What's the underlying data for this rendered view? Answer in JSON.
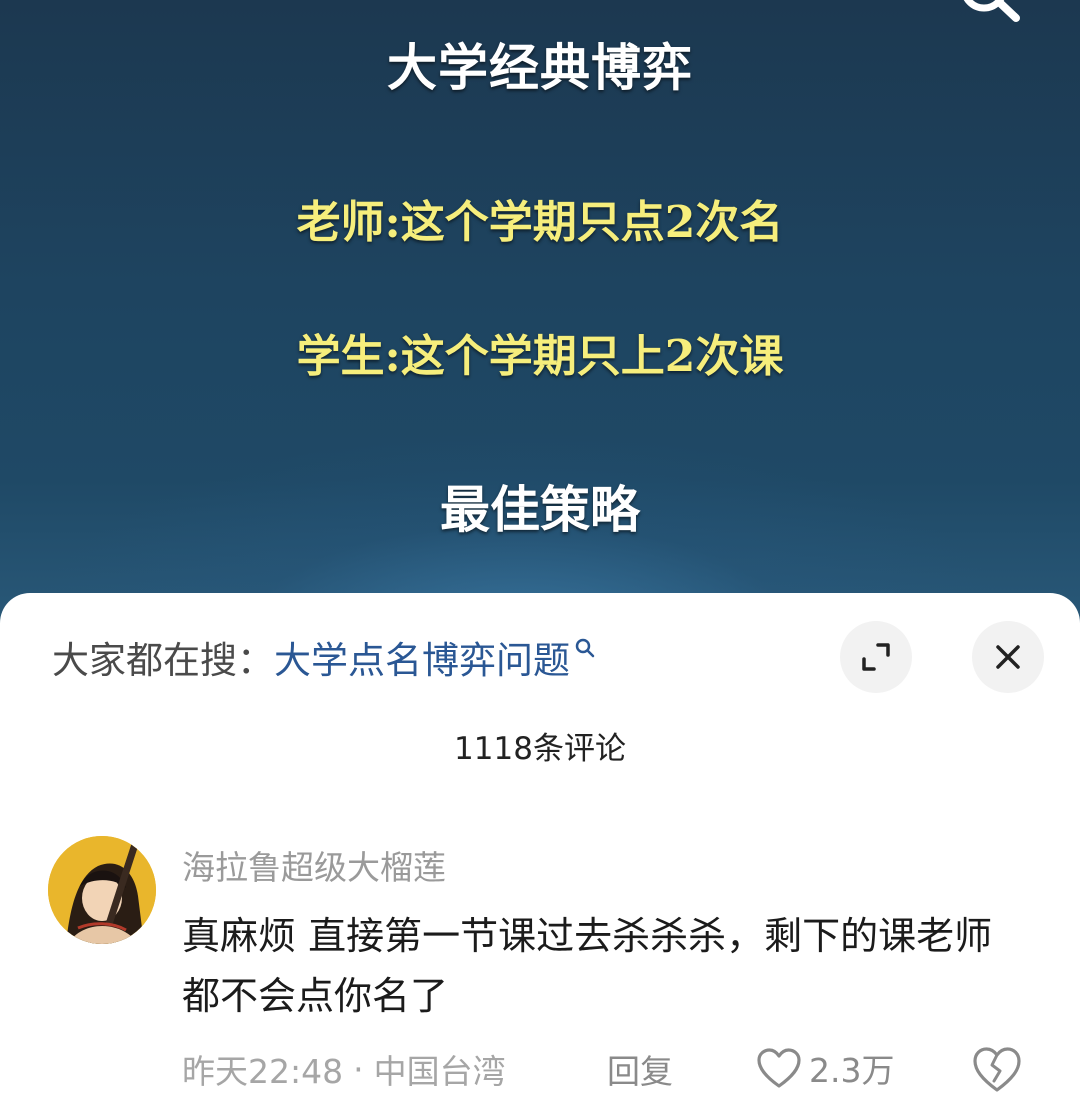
{
  "video": {
    "title": "大学经典博弈",
    "line_teacher": "老师:这个学期只点2次名",
    "line_student": "学生:这个学期只上2次课",
    "strategy": "最佳策略",
    "search_icon": "search-icon",
    "title_color": "#ffffff",
    "highlight_color": "#f6ee7c"
  },
  "comments_panel": {
    "search_prefix": "大家都在搜：",
    "search_term": "大学点名博弈问题",
    "search_term_color": "#2a5794",
    "expand_icon": "expand-icon",
    "close_icon": "close-icon",
    "comment_count": "1118条评论",
    "comments": [
      {
        "avatar_icon": "avatar",
        "username": "海拉鲁超级大榴莲",
        "text": "真麻烦 直接第一节课过去杀杀杀，剩下的课老师都不会点你名了",
        "time": "昨天22:48",
        "separator": "·",
        "location": "中国台湾",
        "reply_label": "回复",
        "likes": "2.3万",
        "like_icon": "heart-icon",
        "dislike_icon": "broken-heart-icon"
      }
    ]
  }
}
